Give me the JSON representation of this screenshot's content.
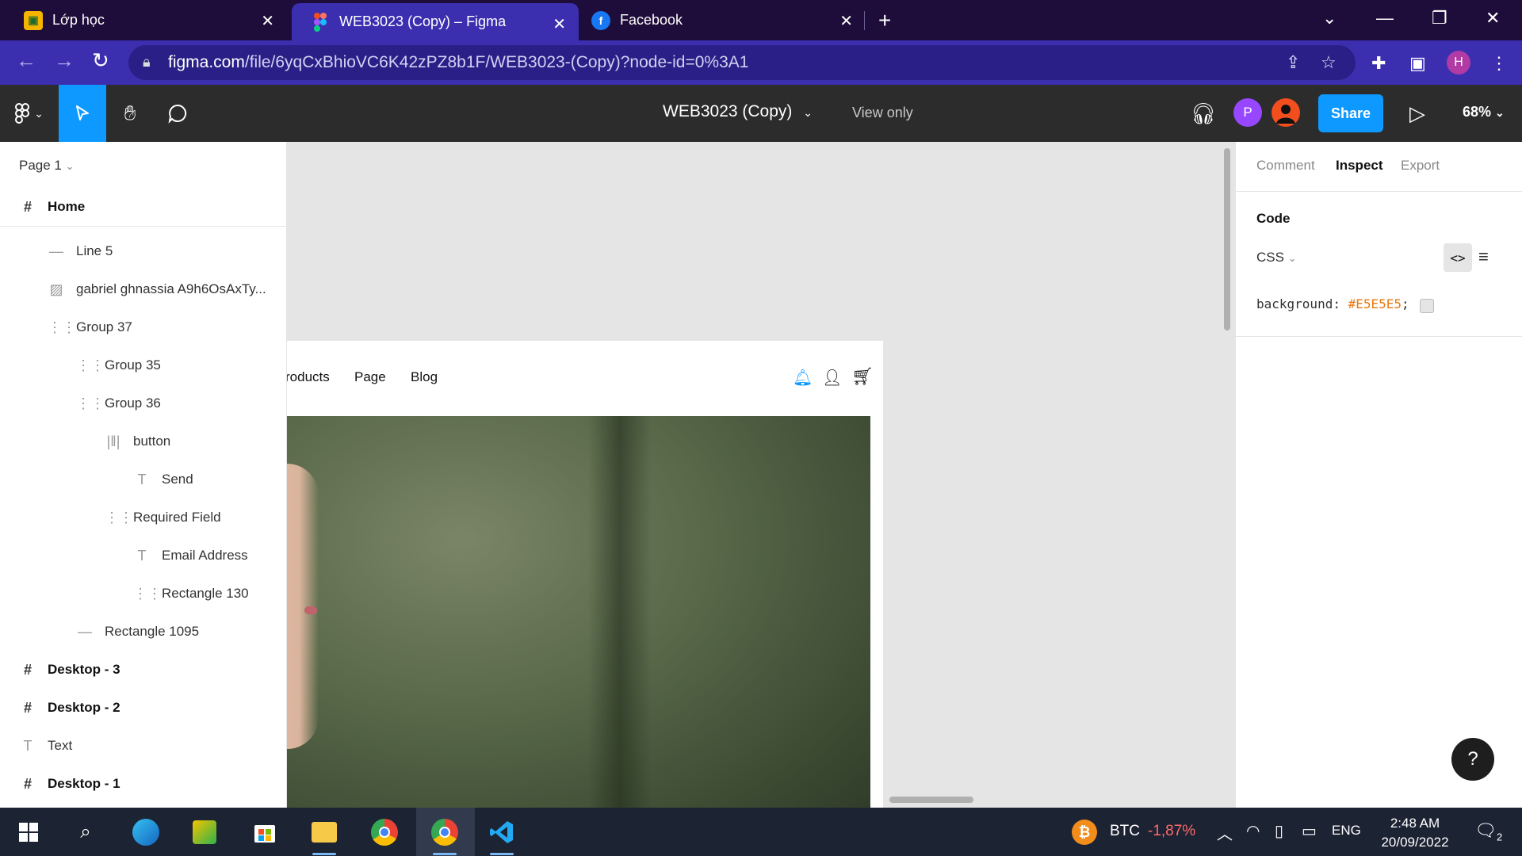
{
  "browser": {
    "tabs": [
      {
        "title": "Lớp học",
        "icon": "classroom-icon",
        "active": false
      },
      {
        "title": "WEB3023 (Copy) – Figma",
        "icon": "figma-icon",
        "active": true
      },
      {
        "title": "Facebook",
        "icon": "facebook-icon",
        "active": false
      }
    ],
    "url_host": "figma.com",
    "url_path": "/file/6yqCxBhioVC6K42zPZ8b1F/WEB3023-(Copy)?node-id=0%3A1",
    "profile_initial": "H"
  },
  "figma": {
    "document_title": "WEB3023 (Copy)",
    "view_mode": "View only",
    "share_label": "Share",
    "zoom": "68%",
    "avatars": [
      {
        "initial": "P",
        "color": "#9747ff"
      },
      {
        "initial": "",
        "color": "#f24e1e"
      }
    ],
    "accent": "#0d99ff"
  },
  "layers": {
    "page": "Page 1",
    "items": [
      {
        "name": "Home",
        "type": "frame"
      },
      {
        "name": "Line 5",
        "type": "line"
      },
      {
        "name": "gabriel ghnassia A9h6OsAxTy...",
        "type": "image"
      },
      {
        "name": "Group 37",
        "type": "group"
      },
      {
        "name": "Group 35",
        "type": "group"
      },
      {
        "name": "Group 36",
        "type": "group"
      },
      {
        "name": "button",
        "type": "component"
      },
      {
        "name": "Send",
        "type": "text"
      },
      {
        "name": "Required Field",
        "type": "group"
      },
      {
        "name": "Email Address",
        "type": "text"
      },
      {
        "name": "Rectangle 130",
        "type": "group"
      },
      {
        "name": "Rectangle 1095",
        "type": "line"
      },
      {
        "name": "Desktop - 3",
        "type": "frame"
      },
      {
        "name": "Desktop - 2",
        "type": "frame"
      },
      {
        "name": "Text",
        "type": "text"
      },
      {
        "name": "Desktop - 1",
        "type": "frame"
      }
    ]
  },
  "canvas": {
    "nav_links": [
      "roducts",
      "Page",
      "Blog"
    ]
  },
  "inspect": {
    "tabs": [
      "Comment",
      "Inspect",
      "Export"
    ],
    "active_tab": "Inspect",
    "code_title": "Code",
    "language": "CSS",
    "code_property": "background:",
    "code_value": "#E5E5E5",
    "code_end": ";",
    "help_label": "?"
  },
  "taskbar": {
    "btc_label": "BTC",
    "btc_change": "-1,87%",
    "btc_change_color": "#ff6b6b",
    "language": "ENG",
    "time": "2:48 AM",
    "date": "20/09/2022",
    "notifications": "2"
  }
}
